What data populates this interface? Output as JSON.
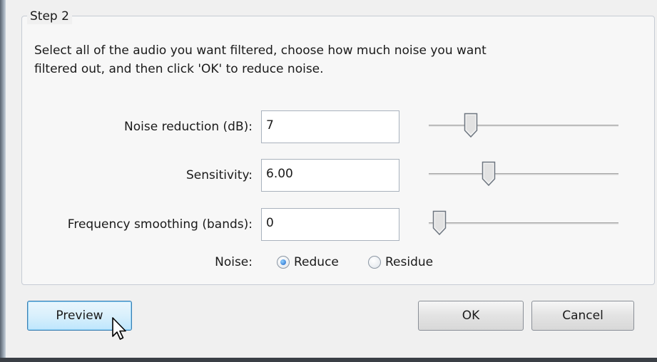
{
  "step": {
    "legend": "Step 2"
  },
  "instructions": {
    "line1": "Select all of the audio you want filtered, choose how much noise you want",
    "line2": "filtered out, and then click 'OK' to reduce noise."
  },
  "params": [
    {
      "label": "Noise reduction (dB):",
      "value": "7",
      "slider_fraction": 0.18
    },
    {
      "label": "Sensitivity:",
      "value": "6.00",
      "slider_fraction": 0.28
    },
    {
      "label": "Frequency smoothing (bands):",
      "value": "0",
      "slider_fraction": 0.0
    }
  ],
  "noise": {
    "label": "Noise:",
    "options": [
      {
        "label": "Reduce",
        "selected": true
      },
      {
        "label": "Residue",
        "selected": false
      }
    ]
  },
  "buttons": {
    "preview": "Preview",
    "ok": "OK",
    "cancel": "Cancel"
  },
  "icons": {
    "slider_thumb": "slider-thumb-icon",
    "cursor": "arrow-cursor-icon"
  }
}
